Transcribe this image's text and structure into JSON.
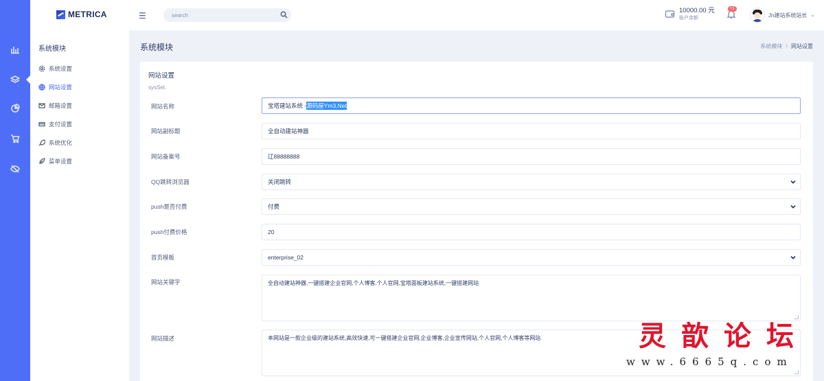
{
  "brand": {
    "name": "METRICA"
  },
  "sidebar": {
    "title": "系统模块",
    "items": [
      {
        "label": "系统设置",
        "icon": "gear-icon"
      },
      {
        "label": "网站设置",
        "icon": "globe-icon",
        "active": true
      },
      {
        "label": "邮箱设置",
        "icon": "mail-icon"
      },
      {
        "label": "支付设置",
        "icon": "card-icon"
      },
      {
        "label": "系统优化",
        "icon": "rocket-icon"
      },
      {
        "label": "菜单设置",
        "icon": "leaf-icon"
      }
    ]
  },
  "topbar": {
    "search_placeholder": "search",
    "balance": "10000.00 元",
    "balance_label": "账户余额",
    "notifications": "+1",
    "username": "Jn建站系统站长"
  },
  "page": {
    "title": "系统模块",
    "breadcrumb": [
      "系统模块",
      "网站设置"
    ]
  },
  "form": {
    "title": "网站设置",
    "subtitle": "sysSet.",
    "fields": [
      {
        "label": "网站名称",
        "value_plain": "宝塔建站系统 - ",
        "value_selected": "源码屋Ym3.Net"
      },
      {
        "label": "网站副标题",
        "value": "全自动建站神器"
      },
      {
        "label": "网站备案号",
        "value": "辽88888888"
      },
      {
        "label": "QQ跳转浏览器",
        "value": "关闭跳转"
      },
      {
        "label": "push是否付费",
        "value": "付费"
      },
      {
        "label": "push付费价格",
        "value": "20"
      },
      {
        "label": "首页模板",
        "value": "enterprise_02"
      },
      {
        "label": "网站关键字",
        "value": "全自动建站神器,一键搭建企业官网,个人博客,个人官网,宝塔面板建站系统,一键搭建网站"
      },
      {
        "label": "网站描述",
        "value": "本网站是一款企业级的建站系统,高效快速,可一键搭建企业官网,企业博客,企业宣传网站,个人官网,个人博客等网站"
      }
    ]
  },
  "watermark": {
    "title": "灵歆论坛",
    "url": "www.6665q.com"
  },
  "colors": {
    "rail": "#4f6ef7",
    "accent": "#4f6ef7",
    "badge": "#f46a6a",
    "watermark": "#e0142c"
  }
}
